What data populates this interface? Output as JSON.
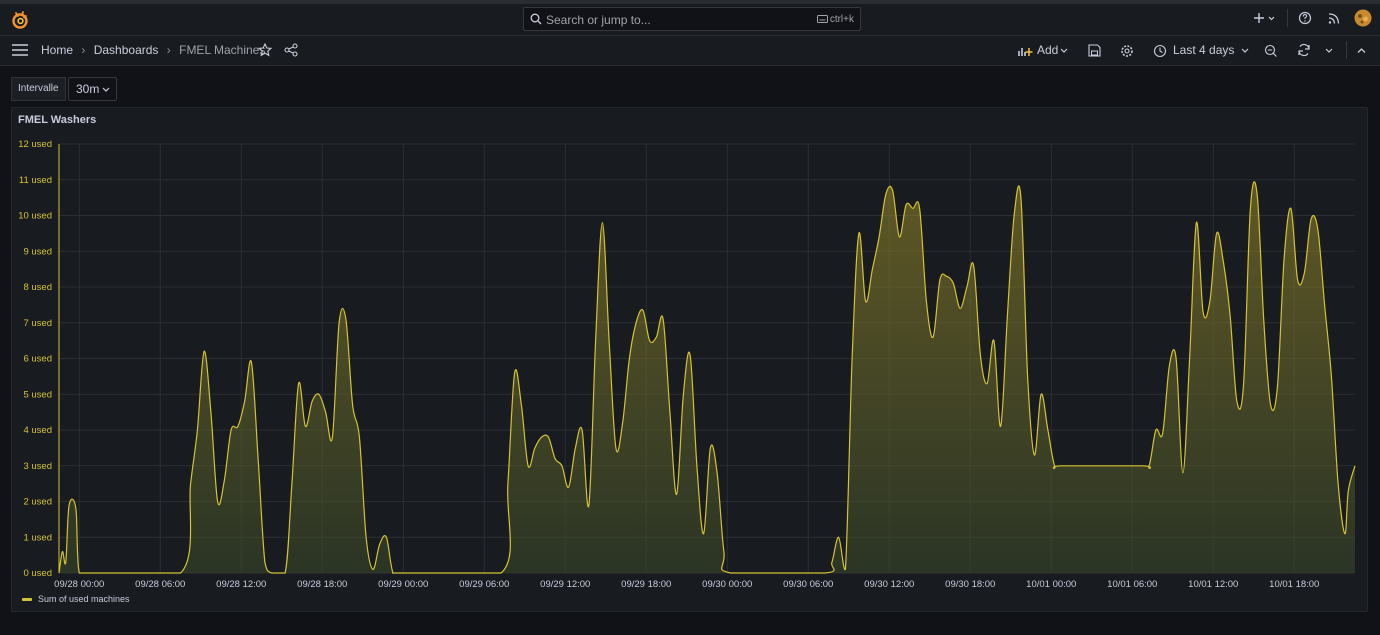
{
  "topbar": {
    "search_placeholder": "Search or jump to...",
    "search_shortcut": "ctrl+k"
  },
  "navbar": {
    "breadcrumbs": [
      "Home",
      "Dashboards",
      "FMEL Machines"
    ],
    "add_label": "Add",
    "time_range": "Last 4 days"
  },
  "variables": {
    "label": "Intervalle",
    "value": "30m"
  },
  "panel": {
    "title": "FMEL Washers",
    "legend_label": "Sum of used machines"
  },
  "colors": {
    "series": "#d6c333",
    "background": "#111217",
    "panel": "#181b1f"
  },
  "chart_data": {
    "type": "area",
    "title": "FMEL Washers",
    "ylabel": "",
    "ylim": [
      0,
      12
    ],
    "y_unit": "used",
    "y_ticks": [
      0,
      1,
      2,
      3,
      4,
      5,
      6,
      7,
      8,
      9,
      10,
      11,
      12
    ],
    "x_ticks": [
      "09/28 00:00",
      "09/28 06:00",
      "09/28 12:00",
      "09/28 18:00",
      "09/29 00:00",
      "09/29 06:00",
      "09/29 12:00",
      "09/29 18:00",
      "09/30 00:00",
      "09/30 06:00",
      "09/30 12:00",
      "09/30 18:00",
      "10/01 00:00",
      "10/01 06:00",
      "10/01 12:00",
      "10/01 18:00"
    ],
    "x_range": [
      "2024-09-27 22:30",
      "2024-10-01 22:30"
    ],
    "grid": true,
    "legend_position": "bottom-left",
    "series": [
      {
        "name": "Sum of used machines",
        "points": [
          [
            "09/27 22:30",
            0
          ],
          [
            "09/27 22:45",
            0.6
          ],
          [
            "09/27 23:00",
            0.3
          ],
          [
            "09/27 23:15",
            1.9
          ],
          [
            "09/27 23:45",
            1.8
          ],
          [
            "09/28 00:00",
            0
          ],
          [
            "09/28 01:00",
            0
          ],
          [
            "09/28 07:30",
            0
          ],
          [
            "09/28 08:15",
            2.5
          ],
          [
            "09/28 08:45",
            4.0
          ],
          [
            "09/28 09:15",
            6.2
          ],
          [
            "09/28 09:45",
            4.5
          ],
          [
            "09/28 10:15",
            2.0
          ],
          [
            "09/28 10:45",
            2.6
          ],
          [
            "09/28 11:15",
            4.0
          ],
          [
            "09/28 11:45",
            4.1
          ],
          [
            "09/28 12:15",
            4.8
          ],
          [
            "09/28 12:45",
            5.9
          ],
          [
            "09/28 13:15",
            3.2
          ],
          [
            "09/28 13:45",
            0.3
          ],
          [
            "09/28 14:15",
            0
          ],
          [
            "09/28 15:15",
            0
          ],
          [
            "09/28 15:45",
            2.5
          ],
          [
            "09/28 16:15",
            5.3
          ],
          [
            "09/28 16:45",
            4.1
          ],
          [
            "09/28 17:15",
            4.8
          ],
          [
            "09/28 17:45",
            5.0
          ],
          [
            "09/28 18:15",
            4.5
          ],
          [
            "09/28 18:45",
            3.8
          ],
          [
            "09/28 19:15",
            7.0
          ],
          [
            "09/28 19:45",
            7.1
          ],
          [
            "09/28 20:15",
            4.7
          ],
          [
            "09/28 20:45",
            3.8
          ],
          [
            "09/28 21:15",
            1.0
          ],
          [
            "09/28 21:45",
            0.1
          ],
          [
            "09/28 22:15",
            0.8
          ],
          [
            "09/28 22:45",
            1.0
          ],
          [
            "09/28 23:15",
            0
          ],
          [
            "09/29 00:00",
            0
          ],
          [
            "09/29 07:15",
            0
          ],
          [
            "09/29 07:45",
            2.5
          ],
          [
            "09/29 08:15",
            5.6
          ],
          [
            "09/29 08:45",
            4.7
          ],
          [
            "09/29 09:15",
            3.0
          ],
          [
            "09/29 09:45",
            3.5
          ],
          [
            "09/29 10:15",
            3.8
          ],
          [
            "09/29 10:45",
            3.8
          ],
          [
            "09/29 11:15",
            3.2
          ],
          [
            "09/29 11:45",
            3.0
          ],
          [
            "09/29 12:15",
            2.4
          ],
          [
            "09/29 12:45",
            3.5
          ],
          [
            "09/29 13:15",
            4.0
          ],
          [
            "09/29 13:45",
            1.9
          ],
          [
            "09/29 14:15",
            6.5
          ],
          [
            "09/29 14:45",
            9.8
          ],
          [
            "09/29 15:15",
            6.5
          ],
          [
            "09/29 15:45",
            3.5
          ],
          [
            "09/29 16:15",
            4.2
          ],
          [
            "09/29 16:45",
            6.0
          ],
          [
            "09/29 17:15",
            7.0
          ],
          [
            "09/29 17:45",
            7.35
          ],
          [
            "09/29 18:15",
            6.5
          ],
          [
            "09/29 18:45",
            6.6
          ],
          [
            "09/29 19:15",
            7.1
          ],
          [
            "09/29 19:45",
            4.5
          ],
          [
            "09/29 20:15",
            2.2
          ],
          [
            "09/29 20:45",
            5.0
          ],
          [
            "09/29 21:15",
            6.1
          ],
          [
            "09/29 21:45",
            3.0
          ],
          [
            "09/29 22:15",
            1.1
          ],
          [
            "09/29 22:45",
            3.5
          ],
          [
            "09/29 23:15",
            2.8
          ],
          [
            "09/29 23:45",
            0.6
          ],
          [
            "09/30 00:15",
            0
          ],
          [
            "09/30 07:15",
            0
          ],
          [
            "09/30 07:45",
            0.3
          ],
          [
            "09/30 08:15",
            1.0
          ],
          [
            "09/30 08:45",
            0.1
          ],
          [
            "09/30 09:15",
            6.0
          ],
          [
            "09/30 09:45",
            9.5
          ],
          [
            "09/30 10:15",
            7.6
          ],
          [
            "09/30 10:45",
            8.5
          ],
          [
            "09/30 11:15",
            9.4
          ],
          [
            "09/30 11:45",
            10.6
          ],
          [
            "09/30 12:15",
            10.7
          ],
          [
            "09/30 12:45",
            9.4
          ],
          [
            "09/30 13:15",
            10.3
          ],
          [
            "09/30 13:45",
            10.2
          ],
          [
            "09/30 14:15",
            10.2
          ],
          [
            "09/30 14:45",
            7.6
          ],
          [
            "09/30 15:15",
            6.6
          ],
          [
            "09/30 15:45",
            8.2
          ],
          [
            "09/30 16:15",
            8.3
          ],
          [
            "09/30 16:45",
            8.1
          ],
          [
            "09/30 17:15",
            7.4
          ],
          [
            "09/30 17:45",
            8.0
          ],
          [
            "09/30 18:15",
            8.6
          ],
          [
            "09/30 18:45",
            6.1
          ],
          [
            "09/30 19:15",
            5.3
          ],
          [
            "09/30 19:45",
            6.5
          ],
          [
            "09/30 20:15",
            4.1
          ],
          [
            "09/30 20:45",
            7.2
          ],
          [
            "09/30 21:15",
            10.0
          ],
          [
            "09/30 21:45",
            10.5
          ],
          [
            "09/30 22:15",
            5.5
          ],
          [
            "09/30 22:45",
            3.3
          ],
          [
            "09/30 23:15",
            5.0
          ],
          [
            "09/30 23:45",
            4.0
          ],
          [
            "10/01 00:15",
            3.0
          ],
          [
            "10/01 00:45",
            3.0
          ],
          [
            "10/01 06:45",
            3.0
          ],
          [
            "10/01 07:15",
            3.0
          ],
          [
            "10/01 07:45",
            4.0
          ],
          [
            "10/01 08:15",
            3.9
          ],
          [
            "10/01 08:45",
            5.8
          ],
          [
            "10/01 09:15",
            6.0
          ],
          [
            "10/01 09:45",
            2.8
          ],
          [
            "10/01 10:15",
            6.0
          ],
          [
            "10/01 10:45",
            9.8
          ],
          [
            "10/01 11:15",
            7.3
          ],
          [
            "10/01 11:45",
            7.6
          ],
          [
            "10/01 12:15",
            9.5
          ],
          [
            "10/01 12:45",
            8.7
          ],
          [
            "10/01 13:15",
            7.2
          ],
          [
            "10/01 13:45",
            4.8
          ],
          [
            "10/01 14:15",
            5.3
          ],
          [
            "10/01 14:45",
            10.2
          ],
          [
            "10/01 15:15",
            10.6
          ],
          [
            "10/01 15:45",
            7.0
          ],
          [
            "10/01 16:15",
            4.7
          ],
          [
            "10/01 16:45",
            5.2
          ],
          [
            "10/01 17:15",
            8.8
          ],
          [
            "10/01 17:45",
            10.2
          ],
          [
            "10/01 18:15",
            8.2
          ],
          [
            "10/01 18:45",
            8.4
          ],
          [
            "10/01 19:15",
            9.9
          ],
          [
            "10/01 19:45",
            9.6
          ],
          [
            "10/01 20:15",
            7.5
          ],
          [
            "10/01 20:45",
            5.5
          ],
          [
            "10/01 21:15",
            2.5
          ],
          [
            "10/01 21:45",
            1.1
          ],
          [
            "10/01 22:00",
            2.3
          ],
          [
            "10/01 22:30",
            3.0
          ]
        ]
      }
    ]
  }
}
